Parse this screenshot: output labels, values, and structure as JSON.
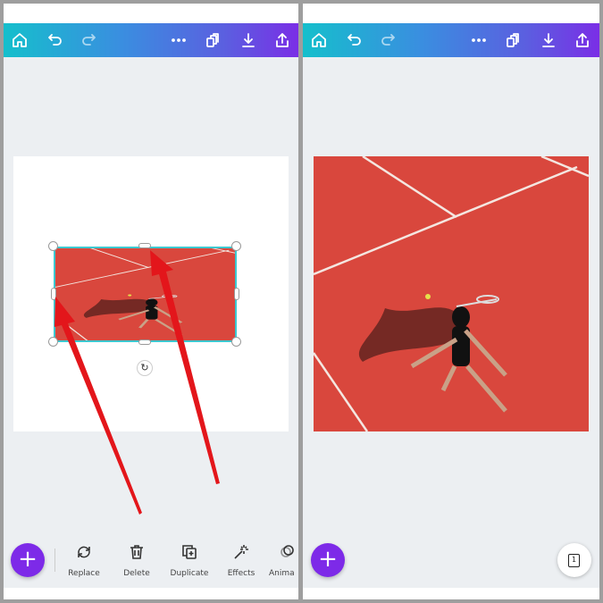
{
  "left_panel": {
    "toolbar": {
      "icons": [
        "home-icon",
        "undo-icon",
        "redo-icon",
        "more-icon",
        "pages-icon",
        "download-icon",
        "share-icon"
      ]
    },
    "actions": [
      {
        "label": "Replace",
        "icon": "replace-icon"
      },
      {
        "label": "Delete",
        "icon": "trash-icon"
      },
      {
        "label": "Duplicate",
        "icon": "duplicate-icon"
      },
      {
        "label": "Effects",
        "icon": "magic-wand-icon"
      },
      {
        "label": "Anima",
        "icon": "animate-icon"
      }
    ],
    "add_label": "+"
  },
  "right_panel": {
    "add_label": "+",
    "page_count": "1"
  },
  "colors": {
    "accent": "#7d2ae8",
    "selection": "#3cc8d0",
    "arrow": "#e3161b",
    "court": "#d9473d"
  }
}
